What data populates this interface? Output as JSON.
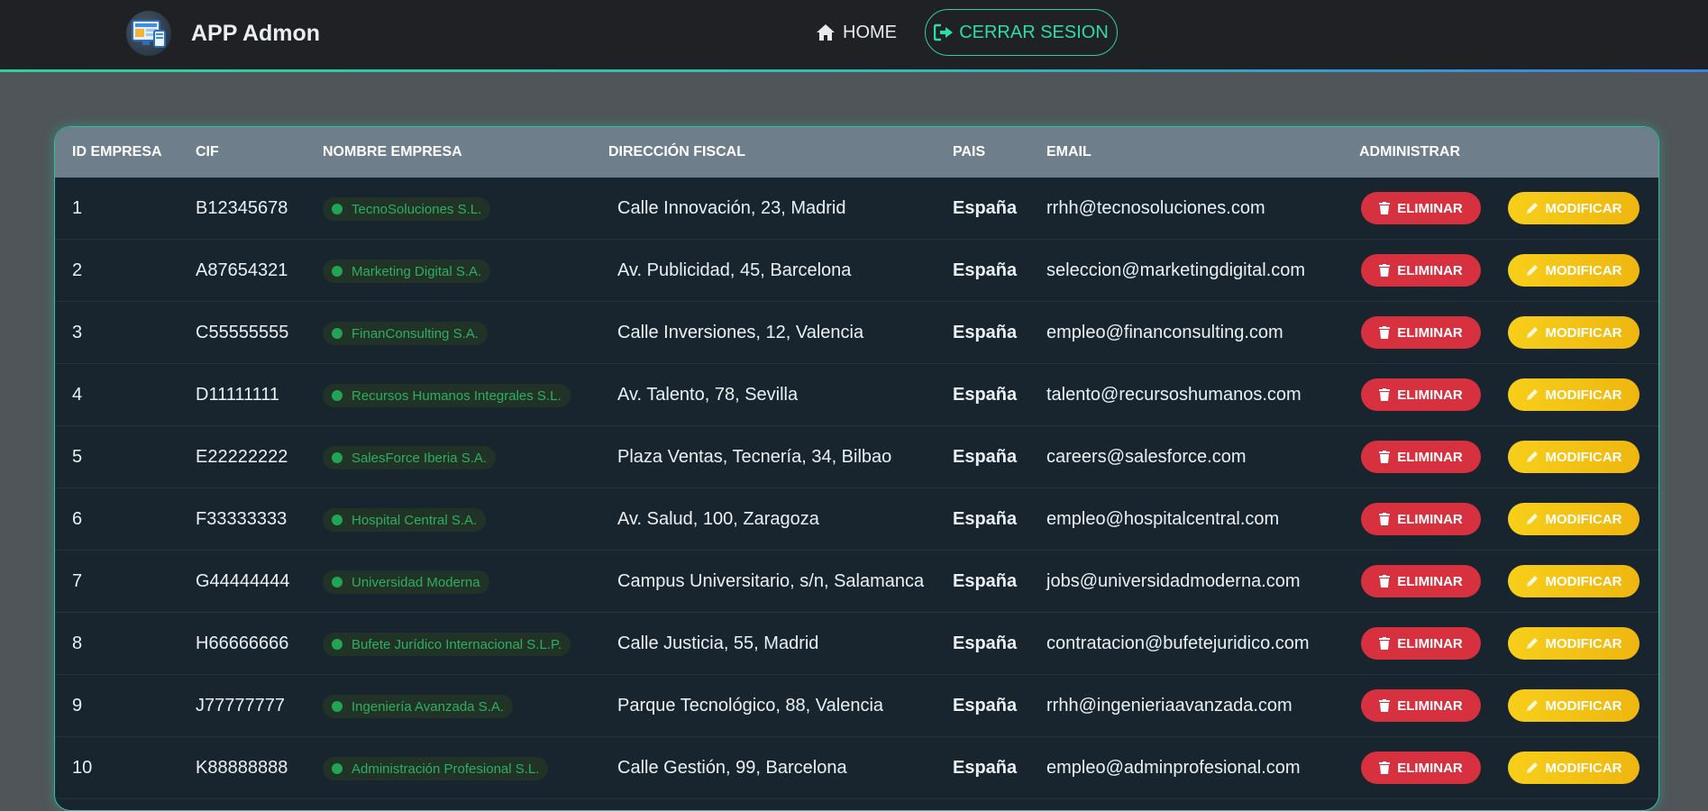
{
  "app": {
    "title": "APP Admon",
    "logo_icon": "computer-screen-icon"
  },
  "nav": {
    "home_label": "HOME",
    "home_icon": "house-icon",
    "logout_label": "CERRAR SESION",
    "logout_icon": "sign-out-icon"
  },
  "colors": {
    "accent": "#2fcf9d",
    "delete": "#d7313f",
    "modify": "#f5c518",
    "badge_text": "#2fae62"
  },
  "table": {
    "headers": {
      "id": "ID EMPRESA",
      "cif": "CIF",
      "nombre": "NOMBRE EMPRESA",
      "direccion": "DIRECCIÓN FISCAL",
      "pais": "PAIS",
      "email": "EMAIL",
      "admin": "ADMINISTRAR"
    },
    "actions": {
      "delete_label": "ELIMINAR",
      "delete_icon": "trash-icon",
      "modify_label": "MODIFICAR",
      "modify_icon": "pencil-icon"
    },
    "rows": [
      {
        "id": "1",
        "cif": "B12345678",
        "nombre": "TecnoSoluciones S.L.",
        "direccion": "Calle Innovación, 23, Madrid",
        "pais": "España",
        "email": "rrhh@tecnosoluciones.com"
      },
      {
        "id": "2",
        "cif": "A87654321",
        "nombre": "Marketing Digital S.A.",
        "direccion": "Av. Publicidad, 45, Barcelona",
        "pais": "España",
        "email": "seleccion@marketingdigital.com"
      },
      {
        "id": "3",
        "cif": "C55555555",
        "nombre": "FinanConsulting S.A.",
        "direccion": "Calle Inversiones, 12, Valencia",
        "pais": "España",
        "email": "empleo@financonsulting.com"
      },
      {
        "id": "4",
        "cif": "D11111111",
        "nombre": "Recursos Humanos Integrales S.L.",
        "direccion": "Av. Talento, 78, Sevilla",
        "pais": "España",
        "email": "talento@recursoshumanos.com"
      },
      {
        "id": "5",
        "cif": "E22222222",
        "nombre": "SalesForce Iberia S.A.",
        "direccion": "Plaza Ventas, Tecnería, 34, Bilbao",
        "pais": "España",
        "email": "careers@salesforce.com"
      },
      {
        "id": "6",
        "cif": "F33333333",
        "nombre": "Hospital Central S.A.",
        "direccion": "Av. Salud, 100, Zaragoza",
        "pais": "España",
        "email": "empleo@hospitalcentral.com"
      },
      {
        "id": "7",
        "cif": "G44444444",
        "nombre": "Universidad Moderna",
        "direccion": "Campus Universitario, s/n, Salamanca",
        "pais": "España",
        "email": "jobs@universidadmoderna.com"
      },
      {
        "id": "8",
        "cif": "H66666666",
        "nombre": "Bufete Jurídico Internacional S.L.P.",
        "direccion": "Calle Justicia, 55, Madrid",
        "pais": "España",
        "email": "contratacion@bufetejuridico.com"
      },
      {
        "id": "9",
        "cif": "J77777777",
        "nombre": "Ingeniería Avanzada S.A.",
        "direccion": "Parque Tecnológico, 88, Valencia",
        "pais": "España",
        "email": "rrhh@ingenieriaavanzada.com"
      },
      {
        "id": "10",
        "cif": "K88888888",
        "nombre": "Administración Profesional S.L.",
        "direccion": "Calle Gestión, 99, Barcelona",
        "pais": "España",
        "email": "empleo@adminprofesional.com"
      }
    ]
  }
}
